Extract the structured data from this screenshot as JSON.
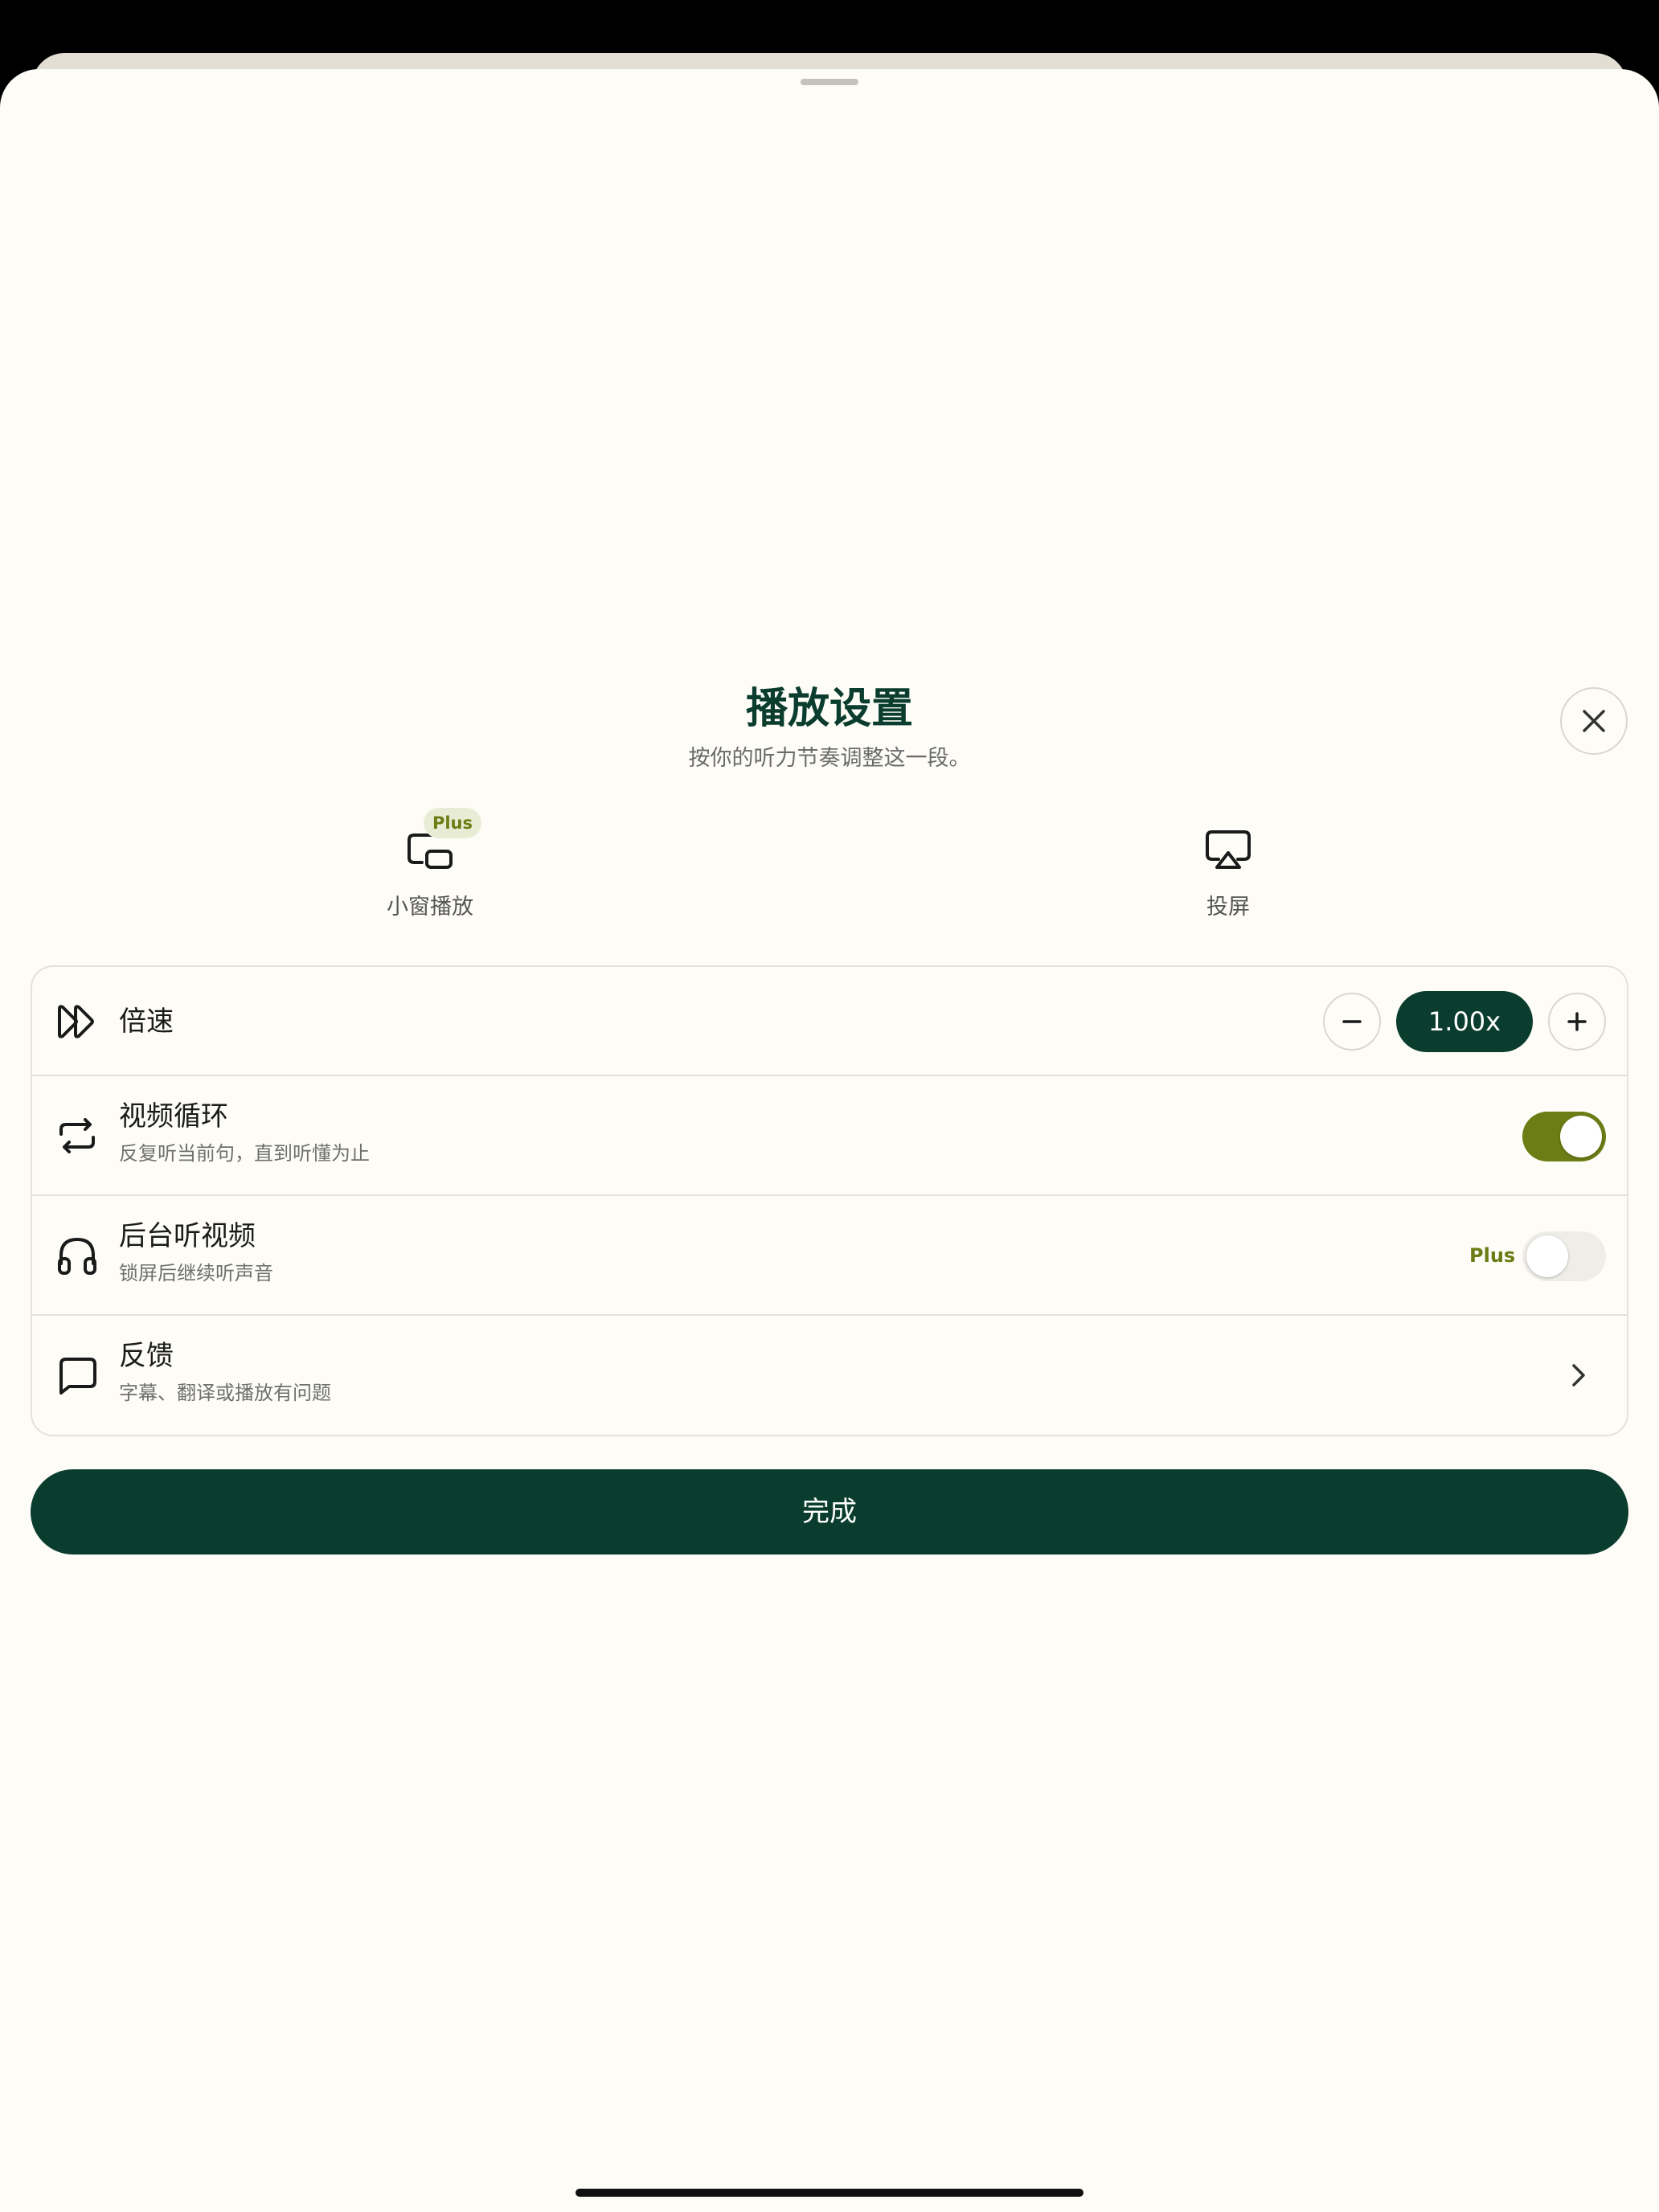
{
  "sheet": {
    "title": "播放设置",
    "subtitle": "按你的听力节奏调整这一段。"
  },
  "quick_actions": [
    {
      "label": "小窗播放",
      "icon": "picture-in-picture-icon",
      "badge": "Plus"
    },
    {
      "label": "投屏",
      "icon": "airplay-icon"
    }
  ],
  "settings": {
    "speed": {
      "title": "倍速",
      "value": "1.00x",
      "icon": "fast-forward-icon"
    },
    "loop": {
      "title": "视频循环",
      "subtitle": "反复听当前句，直到听懂为止",
      "enabled": true,
      "icon": "repeat-icon"
    },
    "background": {
      "title": "后台听视频",
      "subtitle": "锁屏后继续听声音",
      "tag": "Plus",
      "enabled": false,
      "icon": "headphones-icon"
    },
    "feedback": {
      "title": "反馈",
      "subtitle": "字幕、翻译或播放有问题",
      "icon": "message-icon"
    }
  },
  "done_label": "完成",
  "colors": {
    "primary": "#0b3d2e",
    "toggle_on": "#6b7d14",
    "background": "#fdfcf7"
  }
}
